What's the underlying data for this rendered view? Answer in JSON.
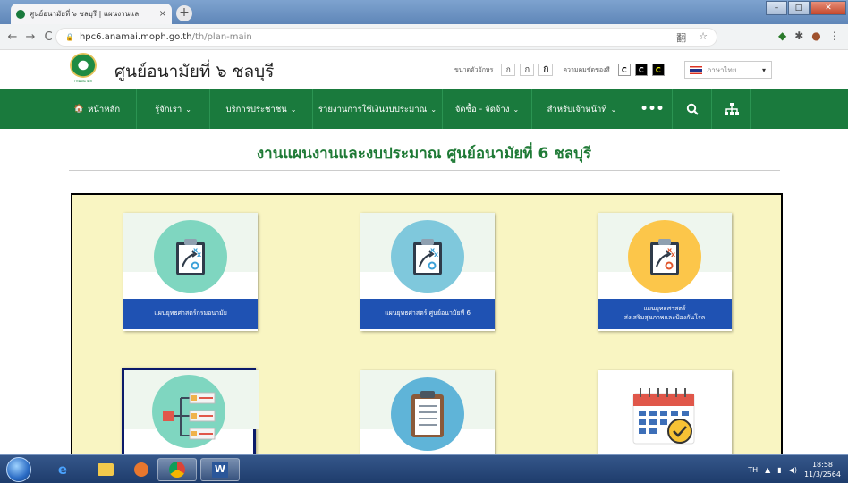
{
  "browser": {
    "tab_title": "ศูนย์อนามัยที่ ๖ ชลบุรี | แผนงานแล",
    "tab_close": "×",
    "new_tab": "+",
    "url_domain": "hpc6.anamai.moph.go.th",
    "url_path": "/th/plan-main",
    "back": "←",
    "forward": "→",
    "reload": "C",
    "translate_icon": "翻",
    "star_icon": "☆",
    "minimize": "–",
    "maximize": "□",
    "close": "✕"
  },
  "site": {
    "title": "ศูนย์อนามัยที่ ๖ ชลบุรี",
    "logo_text": "กรมอนามัย",
    "font_size_label": "ขนาดตัวอักษร",
    "font_sizes": [
      "ก",
      "ก",
      "ก"
    ],
    "contrast_label": "ความคมชัดของสี",
    "contrast_options": [
      "C",
      "C",
      "C"
    ],
    "language": "ภาษาไทย",
    "language_chevron": "▾"
  },
  "nav": {
    "home": "หน้าหลัก",
    "home_icon": "🏠",
    "items": [
      {
        "label": "รู้จักเรา",
        "chevron": "⌄"
      },
      {
        "label": "บริการประชาชน",
        "chevron": "⌄"
      },
      {
        "label": "รายงานการใช้เงินงบประมาณ",
        "chevron": "⌄"
      },
      {
        "label": "จัดซื้อ - จัดจ้าง",
        "chevron": "⌄"
      },
      {
        "label": "สำหรับเจ้าหน้าที่",
        "chevron": "⌄"
      }
    ],
    "more": "•••",
    "search_icon": "🔍",
    "sitemap_icon": "品"
  },
  "page": {
    "heading": "งานแผนงานและงบประมาณ ศูนย์อนามัยที่ 6 ชลบุรี"
  },
  "cards": [
    {
      "line1": "แผนยุทธศาสตร์กรมอนามัย",
      "line2": "",
      "color": "#7fd6c0"
    },
    {
      "line1": "แผนยุทธศาสตร์ ศูนย์อนามัยที่ 6",
      "line2": "",
      "color": "#7fc8dc"
    },
    {
      "line1": "แผนยุทธศาสตร์",
      "line2": "ส่งเสริมสุขภาพและป้องกันโรค",
      "color": "#fcc64a"
    },
    {
      "line1": "",
      "line2": "",
      "color": "#7fd6c0"
    },
    {
      "line1": "",
      "line2": "",
      "color": "#5fb4d8"
    },
    {
      "line1": "",
      "line2": "",
      "color": "#ffffff"
    }
  ],
  "taskbar": {
    "lang": "TH",
    "time": "18:58",
    "date": "11/3/2564"
  }
}
